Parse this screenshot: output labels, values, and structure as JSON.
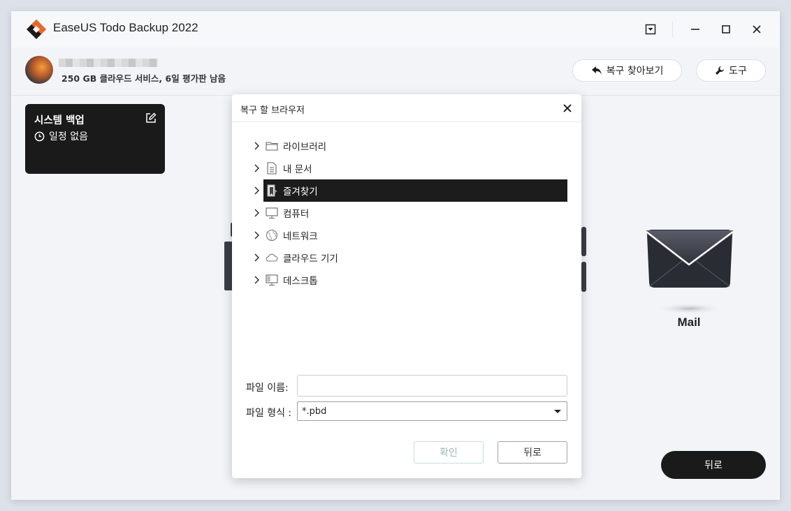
{
  "app": {
    "title": "EaseUS Todo Backup 2022"
  },
  "account": {
    "info": "250 GB 클라우드 서비스, 6일 평가판 남음"
  },
  "header": {
    "browse_recovery_label": "복구 찾아보기",
    "tools_label": "도구"
  },
  "backup_card": {
    "title": "시스템 백업",
    "schedule": "일정 없음"
  },
  "mail_tile": {
    "label": "Mail"
  },
  "main": {
    "back_label": "뒤로"
  },
  "dialog": {
    "title": "복구 할 브라우저",
    "tree": [
      {
        "label": "라이브러리",
        "icon": "folder-icon"
      },
      {
        "label": "내 문서",
        "icon": "document-icon"
      },
      {
        "label": "즐겨찾기",
        "icon": "favorites-icon",
        "selected": true
      },
      {
        "label": "컴퓨터",
        "icon": "monitor-icon"
      },
      {
        "label": "네트워크",
        "icon": "network-icon"
      },
      {
        "label": "클라우드 기기",
        "icon": "cloud-icon"
      },
      {
        "label": "데스크톱",
        "icon": "desktop-icon"
      }
    ],
    "file_name_label": "파일 이름:",
    "file_name_value": "",
    "file_type_label": "파일 형식 :",
    "file_type_value": "*.pbd",
    "confirm_label": "확인",
    "back_label": "뒤로"
  }
}
